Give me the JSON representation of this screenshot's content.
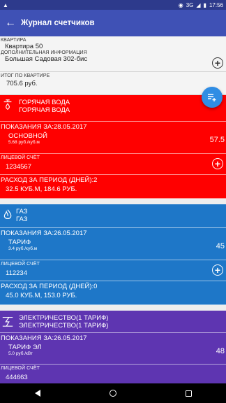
{
  "status": {
    "time": "17:56",
    "network": "3G"
  },
  "appbar": {
    "title": "Журнал счетчиков"
  },
  "apartment": {
    "label": "КВАРТИРА",
    "name": "Квартира 50",
    "extra_label": "ДОПОЛНИТЕЛЬНАЯ ИНФОРМАЦИЯ",
    "address": "Большая Садовая 302-бис",
    "total_label": "ИТОГ ПО КВАРТИРЕ",
    "total": "705.6 руб."
  },
  "utilities": [
    {
      "color": "#ff0000",
      "name1": "ГОРЯЧАЯ ВОДА",
      "name2": "ГОРЯЧАЯ ВОДА",
      "readings_label": "ПОКАЗАНИЯ ЗА:28.05.2017",
      "tariff": "ОСНОВНОЙ",
      "rate": "5.68 руб./куб.м",
      "reading": "57.5",
      "account_label": "ЛИЦЕВОЙ СЧЁТ",
      "account": "1234567",
      "usage_label": "РАСХОД ЗА ПЕРИОД (ДНЕЙ):2",
      "usage": "32.5 КУБ.М, 184.6 РУБ."
    },
    {
      "color": "#1e77c8",
      "name1": "ГАЗ",
      "name2": "ГАЗ",
      "readings_label": "ПОКАЗАНИЯ ЗА:26.05.2017",
      "tariff": "ТАРИФ",
      "rate": "3.4 руб./куб.м",
      "reading": "45",
      "account_label": "ЛИЦЕВОЙ СЧЁТ",
      "account": "112234",
      "usage_label": "РАСХОД ЗА ПЕРИОД (ДНЕЙ):0",
      "usage": "45.0 КУБ.М, 153.0 РУБ."
    },
    {
      "color": "#5e35b1",
      "name1": "ЭЛЕКТРИЧЕСТВО(1 ТАРИФ)",
      "name2": "ЭЛЕКТРИЧЕСТВО(1 ТАРИФ)",
      "readings_label": "ПОКАЗАНИЯ ЗА:26.05.2017",
      "tariff": "ТАРИФ ЭЛ",
      "rate": "5.0 руб./кВт",
      "reading": "48",
      "account_label": "ЛИЦЕВОЙ СЧЁТ",
      "account": "444663"
    }
  ]
}
